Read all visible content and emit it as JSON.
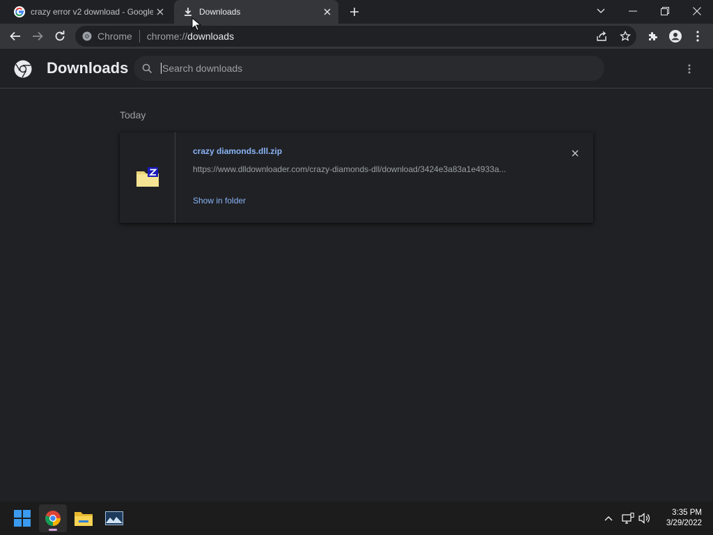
{
  "tabs": [
    {
      "title": "crazy error v2 download - Google Search",
      "icon": "google-icon",
      "active": false
    },
    {
      "title": "Downloads",
      "icon": "download-icon",
      "active": true
    }
  ],
  "omnibox": {
    "site_label": "Chrome",
    "url_scheme": "chrome://",
    "url_path": "downloads"
  },
  "downloads_page": {
    "title": "Downloads",
    "search_placeholder": "Search downloads",
    "section_date": "Today",
    "items": [
      {
        "file_name": "crazy diamonds.dll.zip",
        "url": "https://www.dlldownloader.com/crazy-diamonds-dll/download/3424e3a83a1e4933a...",
        "action_label": "Show in folder",
        "icon": "zip-folder-icon"
      }
    ]
  },
  "taskbar": {
    "time": "3:35 PM",
    "date": "3/29/2022",
    "apps": [
      "windows-start-icon",
      "chrome-icon",
      "file-explorer-icon",
      "photos-icon"
    ]
  },
  "colors": {
    "background": "#202124",
    "toolbar": "#35363a",
    "link": "#8ab4f8",
    "taskbar": "#1c1c1c"
  }
}
